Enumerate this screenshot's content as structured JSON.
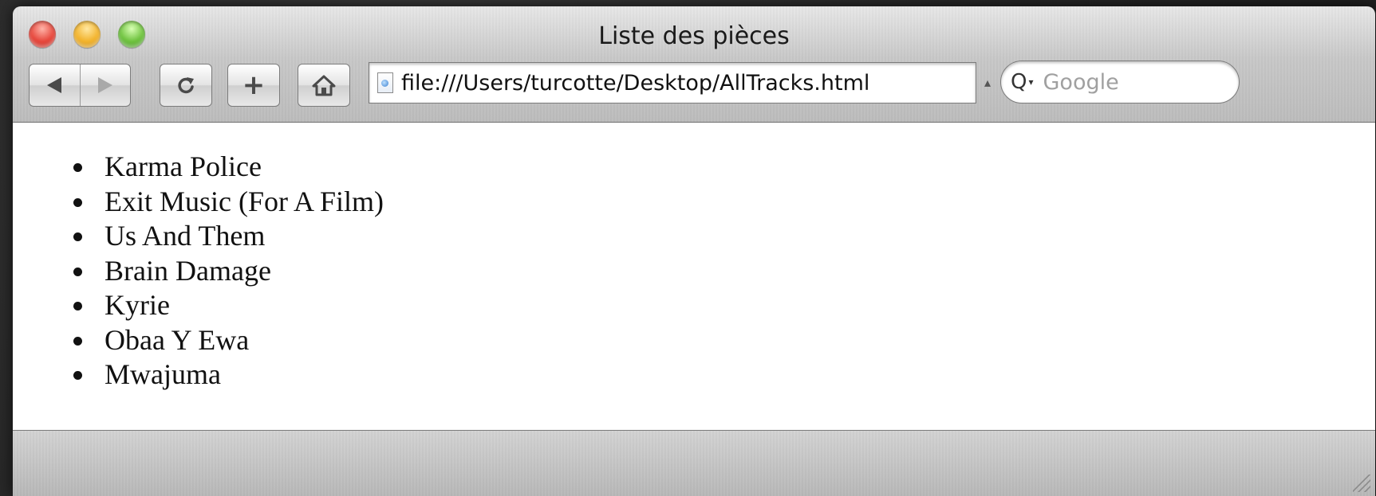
{
  "window": {
    "title": "Liste des pièces"
  },
  "toolbar": {
    "back_icon": "back-arrow-icon",
    "forward_icon": "forward-arrow-icon",
    "reload_icon": "reload-icon",
    "add_label": "+",
    "home_icon": "home-icon",
    "address": "file:///Users/turcotte/Desktop/AllTracks.html",
    "search_placeholder": "Google"
  },
  "page": {
    "tracks": [
      "Karma Police",
      "Exit Music (For A Film)",
      "Us And Them",
      "Brain Damage",
      "Kyrie",
      "Obaa Y Ewa",
      "Mwajuma"
    ]
  }
}
